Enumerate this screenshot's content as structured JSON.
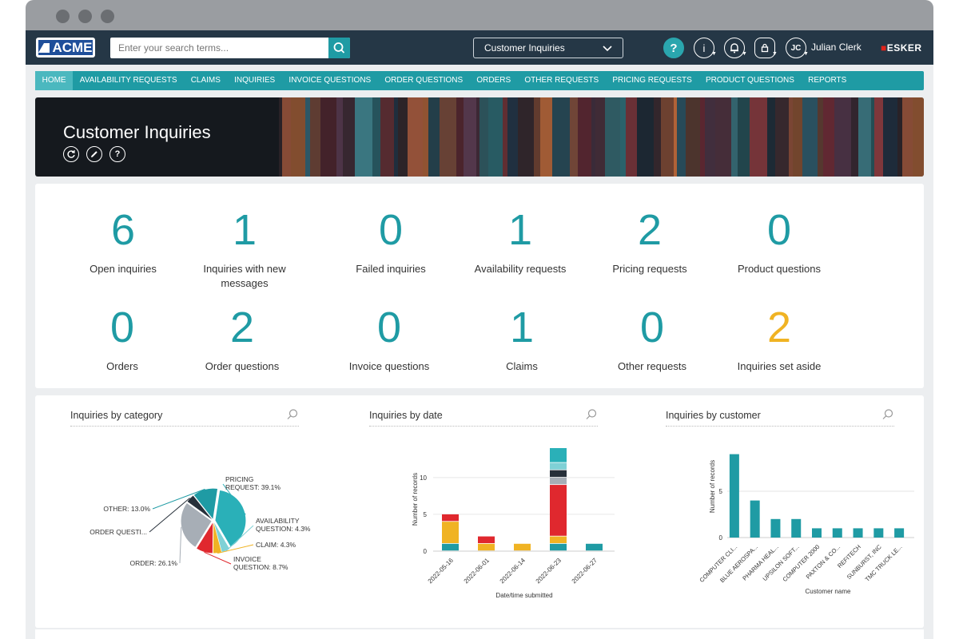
{
  "app": {
    "logo_text": "ACME",
    "search_placeholder": "Enter your search terms...",
    "view_selector": "Customer Inquiries",
    "user_initials": "JC",
    "user_name": "Julian Clerk",
    "brand": "ESKER"
  },
  "nav": [
    {
      "label": "HOME",
      "active": true
    },
    {
      "label": "AVAILABILITY REQUESTS"
    },
    {
      "label": "CLAIMS"
    },
    {
      "label": "INQUIRIES"
    },
    {
      "label": "INVOICE QUESTIONS"
    },
    {
      "label": "ORDER QUESTIONS"
    },
    {
      "label": "ORDERS"
    },
    {
      "label": "OTHER REQUESTS"
    },
    {
      "label": "PRICING REQUESTS"
    },
    {
      "label": "PRODUCT QUESTIONS"
    },
    {
      "label": "REPORTS"
    }
  ],
  "banner": {
    "title": "Customer Inquiries",
    "icons": [
      "refresh-icon",
      "edit-icon",
      "help-icon"
    ]
  },
  "stats": [
    {
      "value": "6",
      "label": "Open inquiries"
    },
    {
      "value": "1",
      "label": "Inquiries with new messages"
    },
    {
      "value": "0",
      "label": "Failed inquiries"
    },
    {
      "value": "1",
      "label": "Availability requests"
    },
    {
      "value": "2",
      "label": "Pricing requests"
    },
    {
      "value": "0",
      "label": "Product questions"
    },
    {
      "value": "0",
      "label": "Orders"
    },
    {
      "value": "2",
      "label": "Order questions"
    },
    {
      "value": "0",
      "label": "Invoice questions"
    },
    {
      "value": "1",
      "label": "Claims"
    },
    {
      "value": "0",
      "label": "Other requests"
    },
    {
      "value": "2",
      "label": "Inquiries set aside",
      "highlight": true
    }
  ],
  "colors": {
    "accent": "#1f9ba4",
    "navy": "#253746",
    "yellow": "#f0b323",
    "red": "#e0282e",
    "gray": "#a7aeb6",
    "dark": "#27303a",
    "light_teal": "#3fb9c2"
  },
  "chart_data": [
    {
      "type": "pie",
      "title": "Inquiries by category",
      "slices": [
        {
          "label": "PRICING REQUEST: 39.1%",
          "value": 39.1,
          "color": "#2ab0b8"
        },
        {
          "label": "AVAILABILITY QUESTION: 4.3%",
          "value": 4.3,
          "color": "#7fd1d6"
        },
        {
          "label": "CLAIM: 4.3%",
          "value": 4.3,
          "color": "#f0b323"
        },
        {
          "label": "INVOICE QUESTION: 8.7%",
          "value": 8.7,
          "color": "#e0282e"
        },
        {
          "label": "ORDER: 26.1%",
          "value": 26.1,
          "color": "#a7aeb6"
        },
        {
          "label": "ORDER QUESTI...",
          "value": 4.3,
          "color": "#27303a"
        },
        {
          "label": "OTHER: 13.0%",
          "value": 13.0,
          "color": "#1f9ba4"
        }
      ]
    },
    {
      "type": "bar",
      "stacked": true,
      "title": "Inquiries by date",
      "xlabel": "Date/time submitted",
      "ylabel": "Number of records",
      "categories": [
        "2022-05-16",
        "2022-06-01",
        "2022-06-14",
        "2022-06-23",
        "2022-06-27"
      ],
      "yticks": [
        0,
        5,
        10
      ],
      "ylim": [
        0,
        14
      ],
      "series": [
        {
          "values": [
            1,
            0,
            0,
            1,
            1
          ],
          "color": "#1f9ba4"
        },
        {
          "values": [
            3,
            1,
            1,
            1,
            0
          ],
          "color": "#f0b323"
        },
        {
          "values": [
            1,
            1,
            0,
            7,
            0
          ],
          "color": "#e0282e"
        },
        {
          "values": [
            0,
            0,
            0,
            1,
            0
          ],
          "color": "#a7aeb6"
        },
        {
          "values": [
            0,
            0,
            0,
            1,
            0
          ],
          "color": "#27303a"
        },
        {
          "values": [
            0,
            0,
            0,
            1,
            0
          ],
          "color": "#7fd1d6"
        },
        {
          "values": [
            0,
            0,
            0,
            2,
            0
          ],
          "color": "#2ab0b8"
        }
      ]
    },
    {
      "type": "bar",
      "title": "Inquiries by customer",
      "xlabel": "Customer name",
      "ylabel": "Number of records",
      "categories": [
        "COMPUTER CLI...",
        "BLUE AEROSPA...",
        "PHARMA HEAL...",
        "UPSILON SOFT...",
        "COMPUTER 2000",
        "PAXTON & CO...",
        "REFITECH",
        "SUNBURST, INC",
        "TMC TRUCK LE..."
      ],
      "values": [
        9,
        4,
        2,
        2,
        1,
        1,
        1,
        1,
        1
      ],
      "yticks": [
        0,
        5
      ],
      "ylim": [
        0,
        10
      ],
      "color": "#1f9ba4"
    }
  ]
}
